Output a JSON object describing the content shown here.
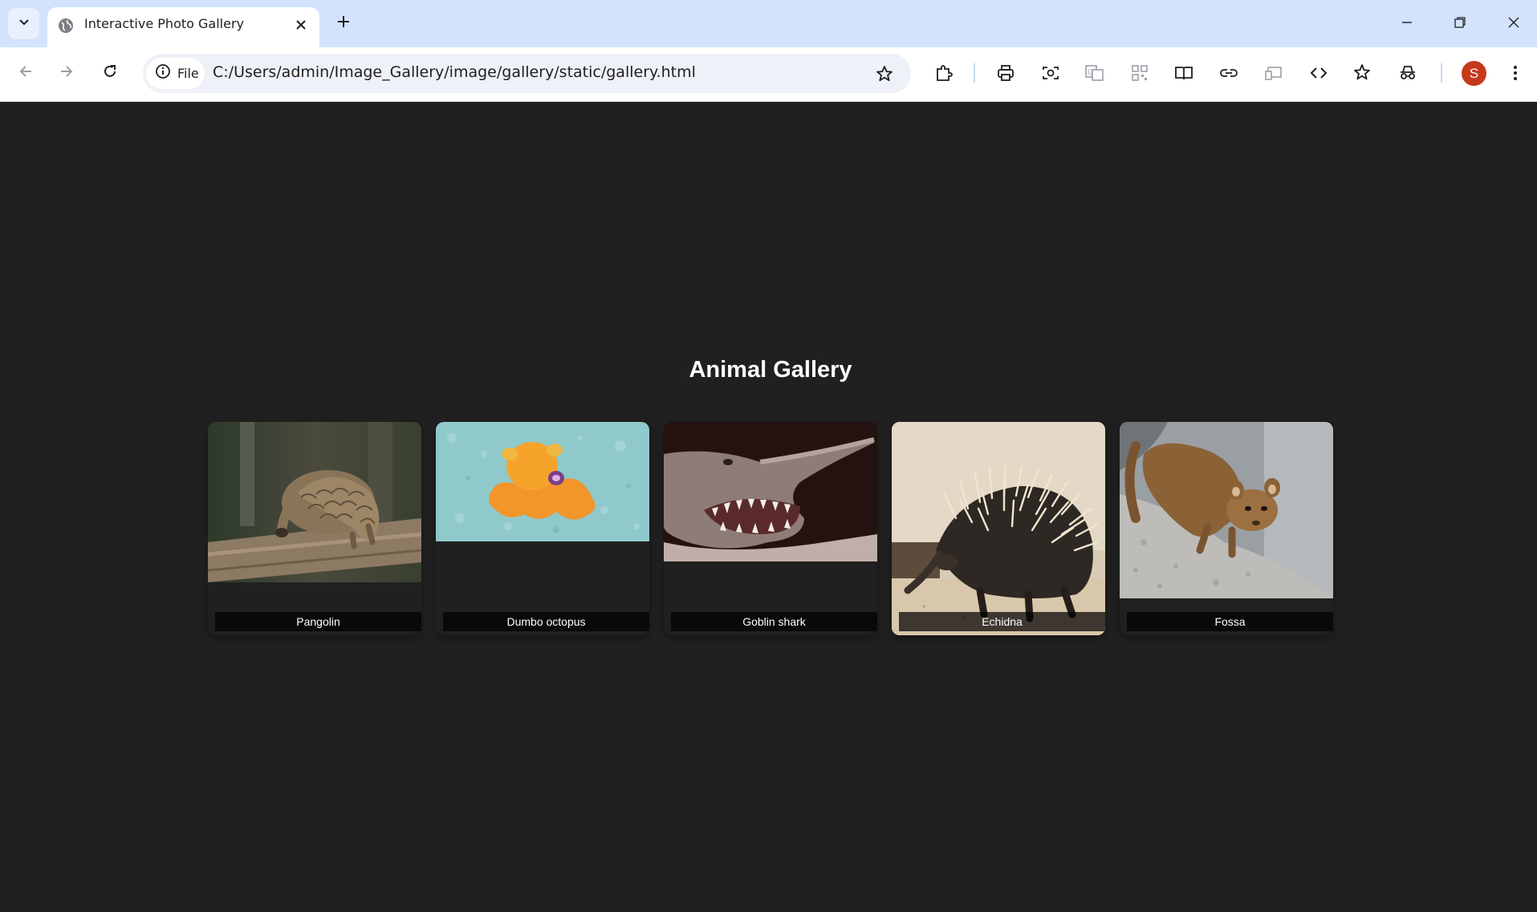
{
  "browser": {
    "tab_title": "Interactive Photo Gallery",
    "chip_label": "File",
    "url": "C:/Users/admin/Image_Gallery/image/gallery/static/gallery.html",
    "avatar_initial": "S",
    "colors": {
      "tabstrip": "#d3e3fd",
      "avatar": "#c5391b"
    }
  },
  "page": {
    "title": "Animal Gallery",
    "background": "#202020",
    "animals": [
      {
        "name": "Pangolin",
        "icon": "pangolin-photo"
      },
      {
        "name": "Dumbo octopus",
        "icon": "dumbo-octopus-photo"
      },
      {
        "name": "Goblin shark",
        "icon": "goblin-shark-photo"
      },
      {
        "name": "Echidna",
        "icon": "echidna-photo"
      },
      {
        "name": "Fossa",
        "icon": "fossa-photo"
      }
    ]
  }
}
